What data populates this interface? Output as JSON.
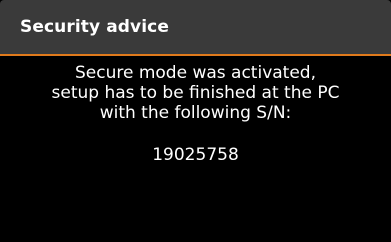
{
  "colors": {
    "background": "#000000",
    "header_background": "#3a3a3a",
    "accent": "#e07a1c",
    "text": "#ffffff"
  },
  "header": {
    "title": "Security advice"
  },
  "message": {
    "lines": [
      "Secure mode was activated,",
      "setup has to be finished at the PC",
      "with the following S/N:"
    ],
    "serial_number": "19025758"
  }
}
